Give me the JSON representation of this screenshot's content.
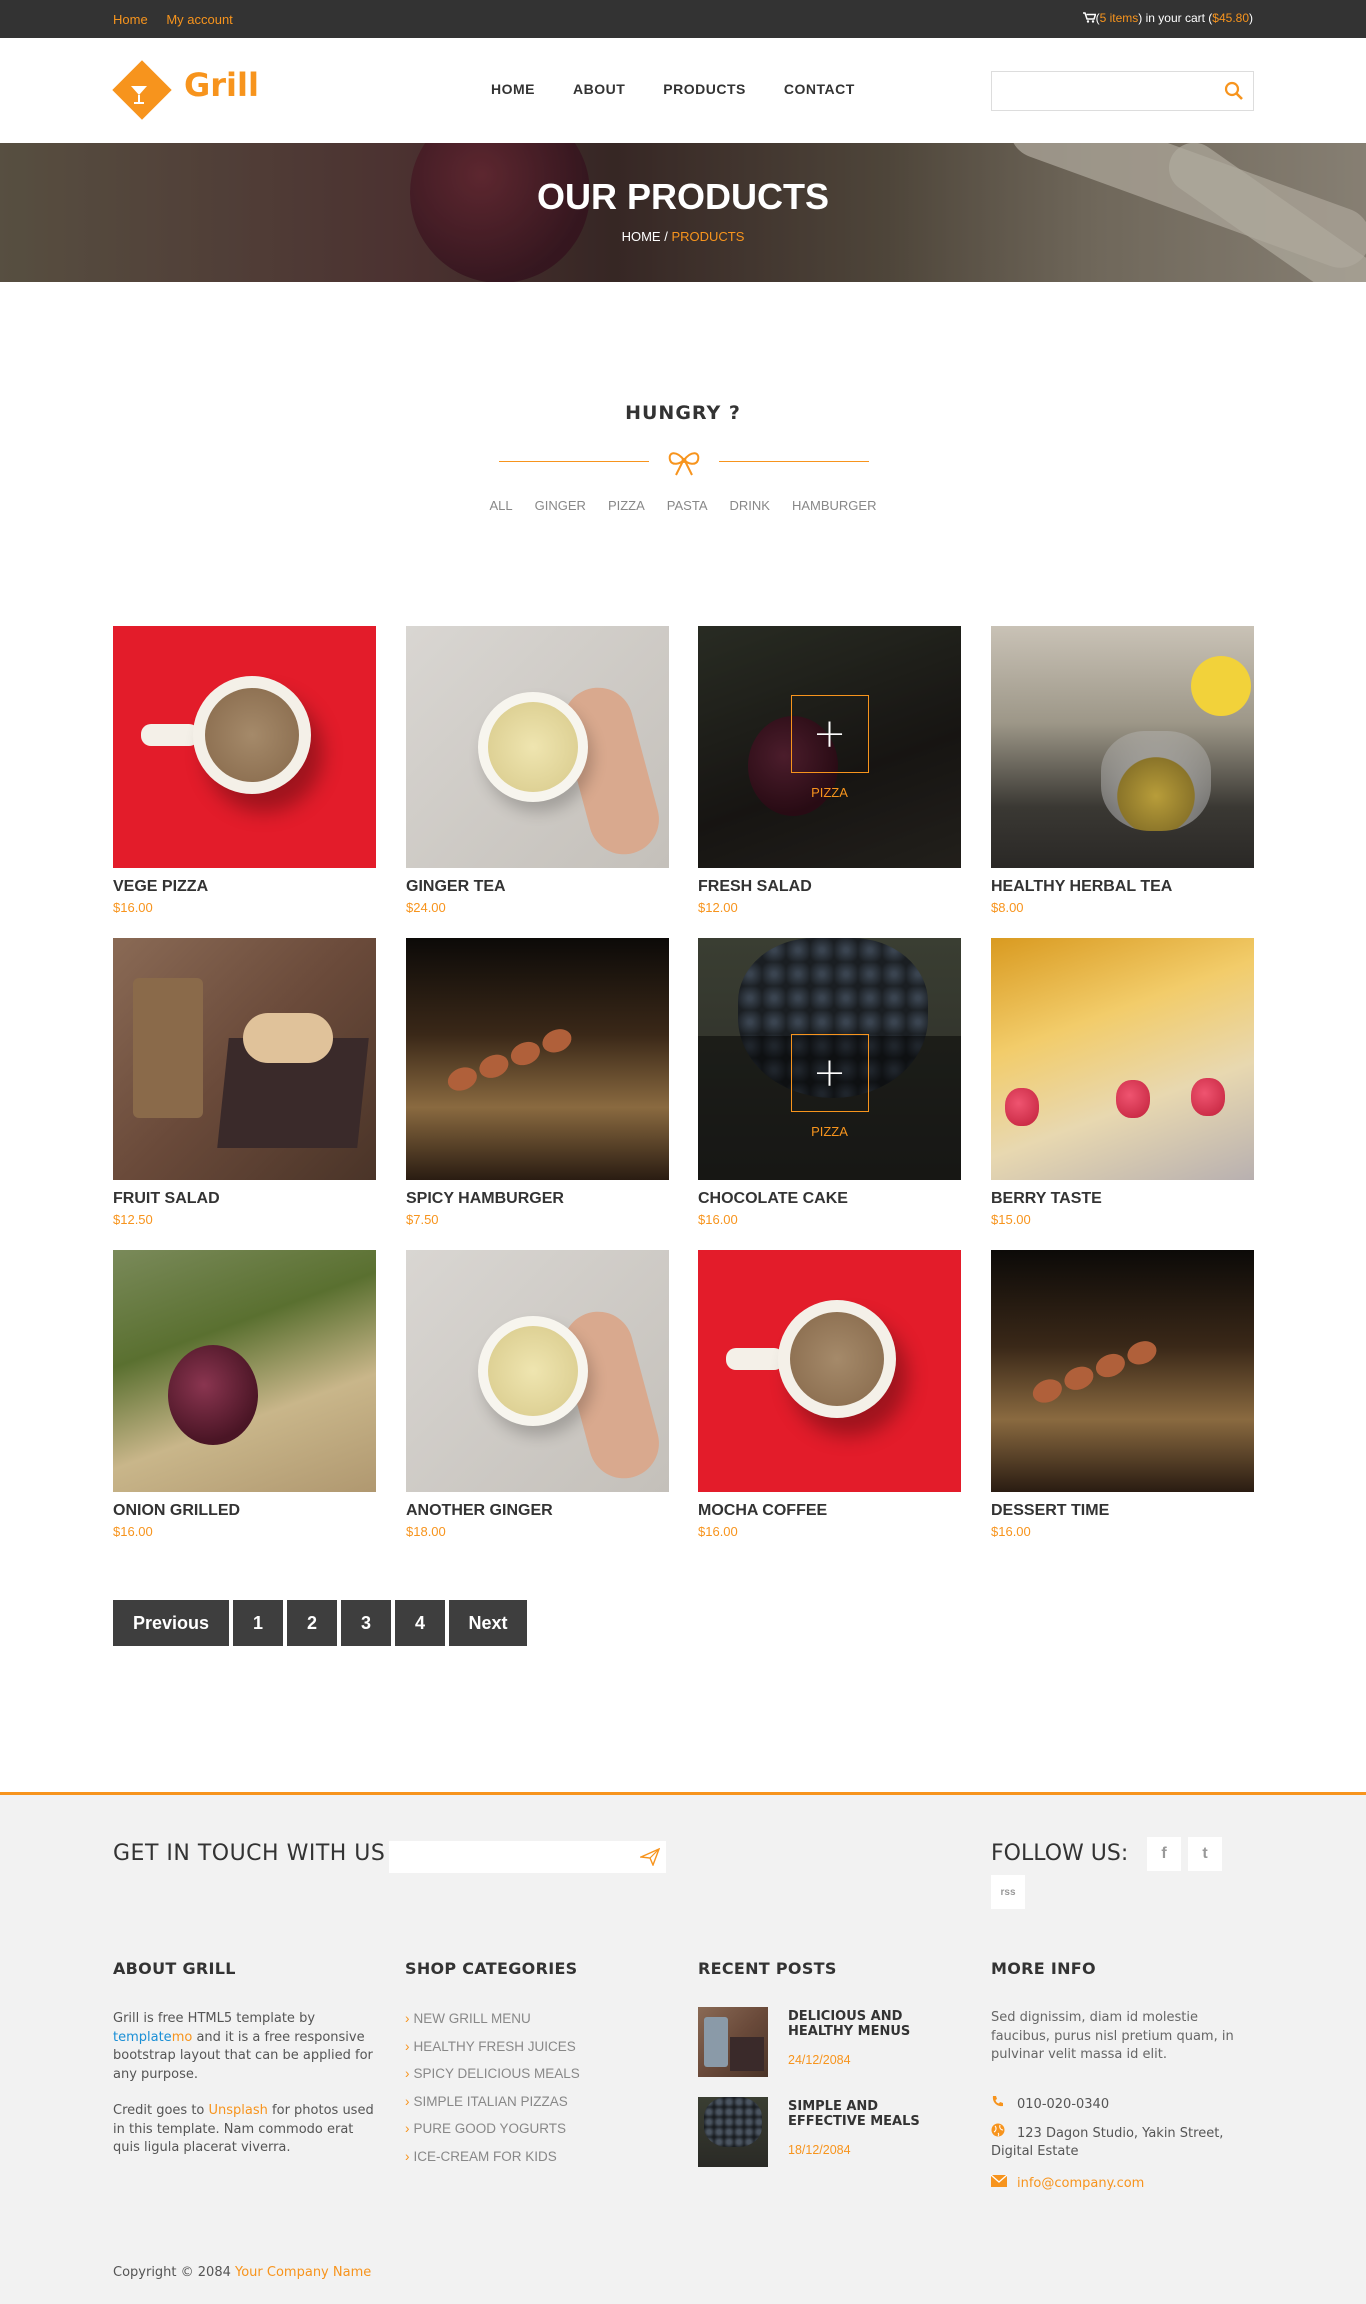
{
  "topbar": {
    "links": [
      "Home",
      "My account"
    ],
    "cart_prefix": "(",
    "cart_items": "5 items",
    "cart_middle": ") in your cart (",
    "cart_total": "$45.80",
    "cart_suffix": ")"
  },
  "header": {
    "logo_text": "Grill",
    "nav": [
      "HOME",
      "ABOUT",
      "PRODUCTS",
      "CONTACT"
    ],
    "search_placeholder": ""
  },
  "banner": {
    "title": "OUR PRODUCTS",
    "crumb_home": "HOME",
    "crumb_sep": " / ",
    "crumb_current": "PRODUCTS"
  },
  "section": {
    "title": "HUNGRY ?",
    "filters": [
      "ALL",
      "GINGER",
      "PIZZA",
      "PASTA",
      "DRINK",
      "HAMBURGER"
    ]
  },
  "products": [
    {
      "name": "VEGE PIZZA",
      "price": "$16.00",
      "image": "mocha-coffee-red"
    },
    {
      "name": "GINGER TEA",
      "price": "$24.00",
      "image": "ginger-tea-bowl"
    },
    {
      "name": "FRESH SALAD",
      "price": "$12.00",
      "image": "onion-dark",
      "overlay": "PIZZA"
    },
    {
      "name": "HEALTHY HERBAL TEA",
      "price": "$8.00",
      "image": "teapot"
    },
    {
      "name": "FRUIT SALAD",
      "price": "$12.50",
      "image": "coffee-macarons"
    },
    {
      "name": "SPICY HAMBURGER",
      "price": "$7.50",
      "image": "spoons-wood"
    },
    {
      "name": "CHOCOLATE CAKE",
      "price": "$16.00",
      "image": "grapes",
      "overlay": "PIZZA"
    },
    {
      "name": "BERRY TASTE",
      "price": "$15.00",
      "image": "raspberries"
    },
    {
      "name": "ONION GRILLED",
      "price": "$16.00",
      "image": "onion-cutting-board"
    },
    {
      "name": "ANOTHER GINGER",
      "price": "$18.00",
      "image": "ginger-tea-bowl"
    },
    {
      "name": "MOCHA COFFEE",
      "price": "$16.00",
      "image": "mocha-coffee-red"
    },
    {
      "name": "DESSERT TIME",
      "price": "$16.00",
      "image": "spoons-wood"
    }
  ],
  "pagination": {
    "previous": "Previous",
    "pages": [
      "1",
      "2",
      "3",
      "4"
    ],
    "next": "Next"
  },
  "footer": {
    "get_in_touch": "GET IN TOUCH WITH US",
    "email_placeholder": "",
    "follow_us": "FOLLOW US:",
    "social": [
      {
        "icon": "facebook-icon",
        "glyph": "f"
      },
      {
        "icon": "twitter-icon",
        "glyph": "t"
      },
      {
        "icon": "rss-icon",
        "glyph": "rss"
      }
    ],
    "about": {
      "heading": "ABOUT GRILL",
      "p1_a": "Grill is free HTML5 template by ",
      "p1_link1": "template",
      "p1_link2": "mo",
      "p1_b": " and it is a free responsive bootstrap layout that can be applied for any purpose.",
      "p2_a": "Credit goes to ",
      "p2_link": "Unsplash",
      "p2_b": " for photos used in this template. Nam commodo erat quis ligula placerat viverra."
    },
    "categories": {
      "heading": "SHOP CATEGORIES",
      "items": [
        "NEW GRILL MENU",
        "HEALTHY FRESH JUICES",
        "SPICY DELICIOUS MEALS",
        "SIMPLE ITALIAN PIZZAS",
        "PURE GOOD YOGURTS",
        "ICE-CREAM FOR KIDS"
      ]
    },
    "recent": {
      "heading": "RECENT POSTS",
      "posts": [
        {
          "title": "DELICIOUS AND HEALTHY MENUS",
          "date": "24/12/2084"
        },
        {
          "title": "SIMPLE AND EFFECTIVE MEALS",
          "date": "18/12/2084"
        }
      ]
    },
    "more": {
      "heading": "MORE INFO",
      "text": "Sed dignissim, diam id molestie faucibus, purus nisl pretium quam, in pulvinar velit massa id elit.",
      "phone": "010-020-0340",
      "address": "123 Dagon Studio, Yakin Street, Digital Estate",
      "email": "info@company.com"
    },
    "copyright_prefix": "Copyright © 2084 ",
    "company": "Your Company Name"
  },
  "colors": {
    "accent": "#f7941d",
    "dark": "#333333",
    "button": "#3e3e3e",
    "footer_bg": "#f2f2f2"
  }
}
